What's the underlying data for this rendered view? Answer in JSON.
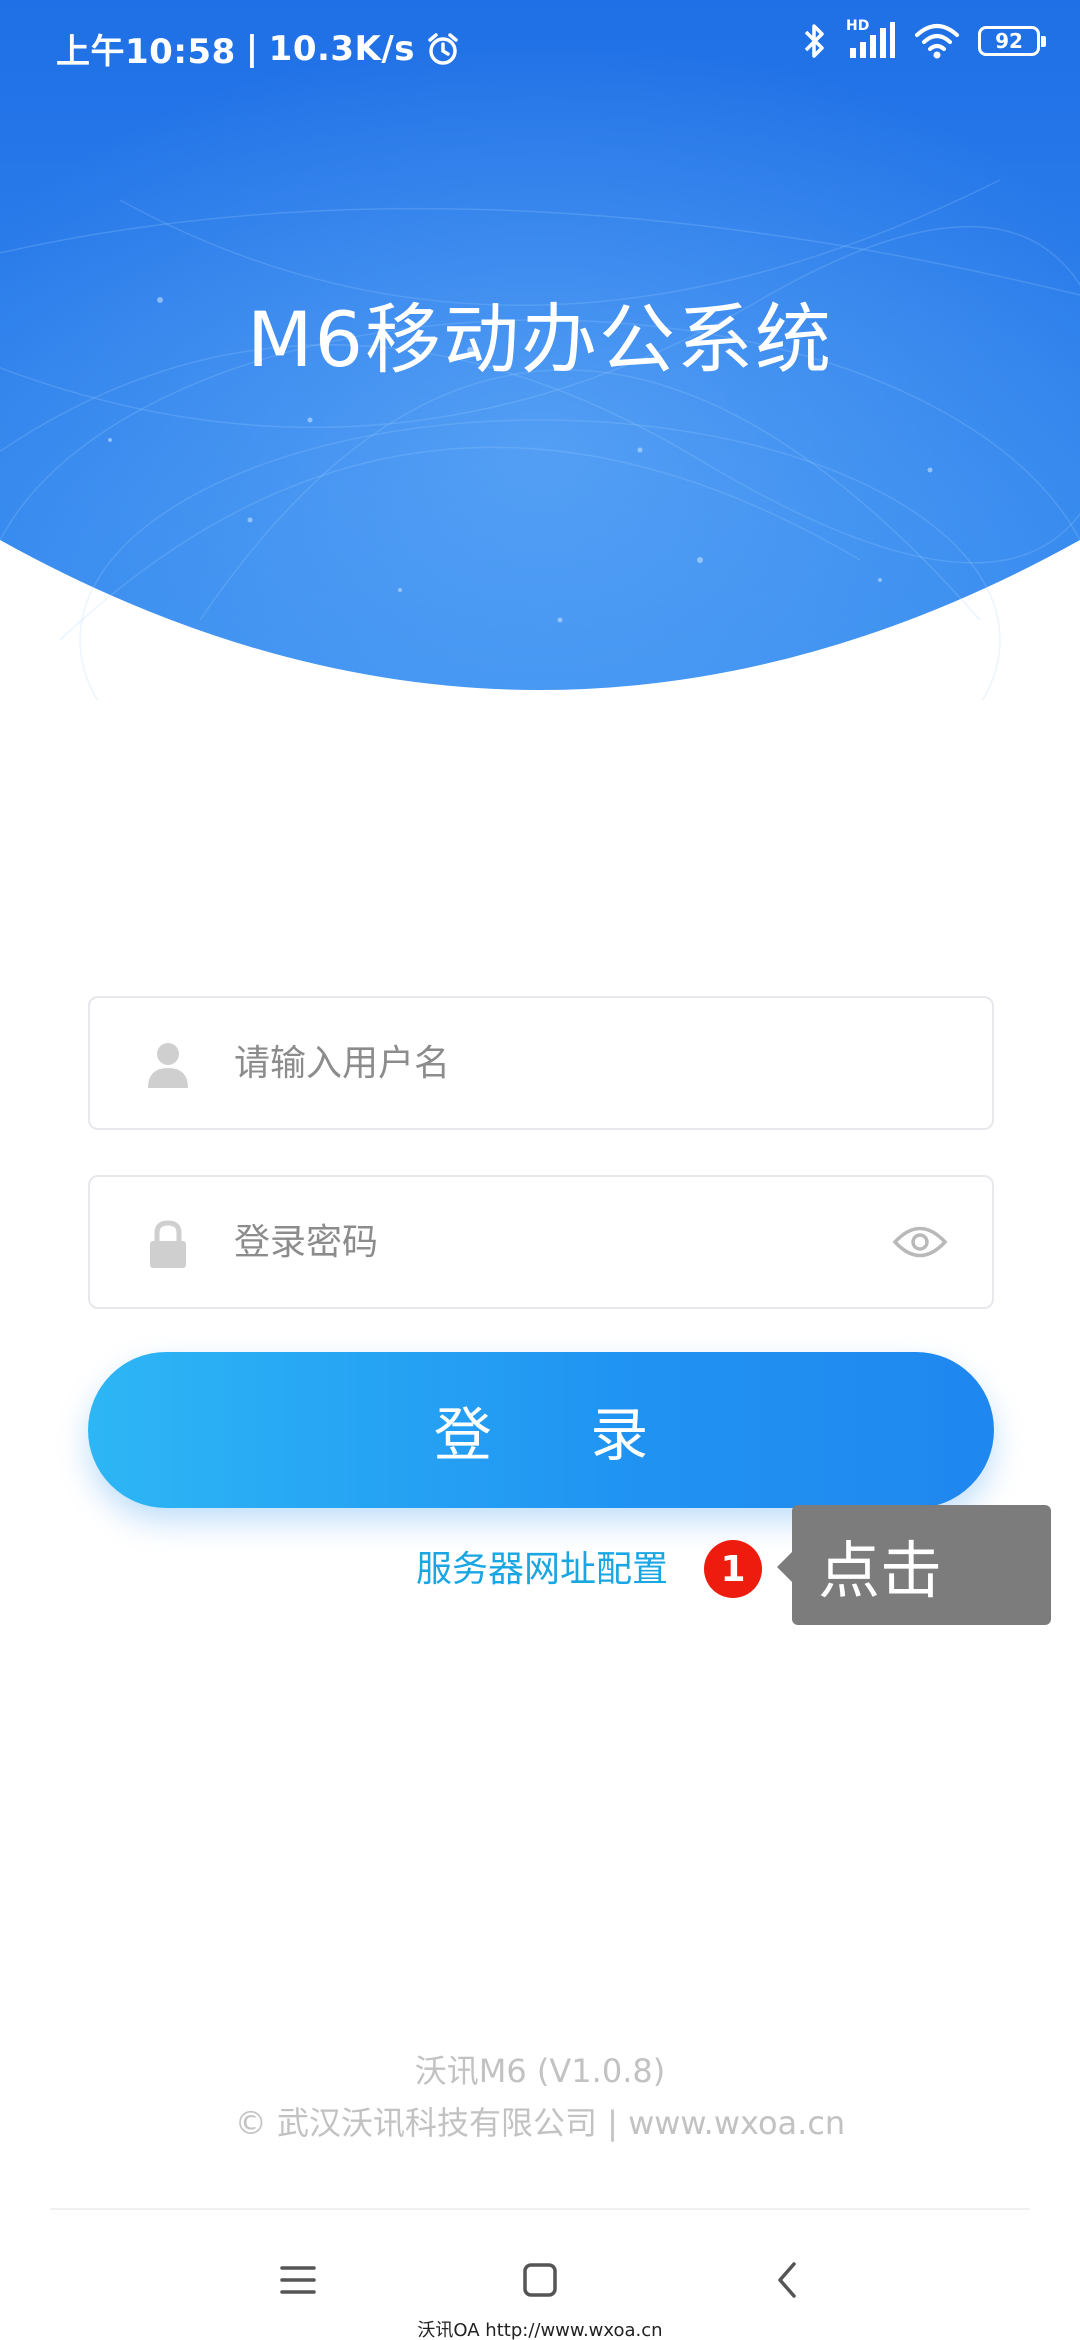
{
  "status_bar": {
    "time": "上午10:58",
    "separator": "|",
    "net_speed": "10.3K/s",
    "alarm_icon": "alarm-clock-icon",
    "bluetooth_icon": "bluetooth-icon",
    "signal_label": "HD",
    "signal_icon": "cellular-signal-icon",
    "wifi_icon": "wifi-icon",
    "battery_level": "92"
  },
  "header": {
    "title": "M6移动办公系统",
    "gradient_top": "#1f6fe6",
    "gradient_bottom": "#3a8ff0"
  },
  "login_form": {
    "username_placeholder": "请输入用户名",
    "username_value": "",
    "username_icon": "user-icon",
    "password_placeholder": "登录密码",
    "password_value": "",
    "password_icon": "lock-icon",
    "toggle_visibility_icon": "eye-icon",
    "login_button": "登 录",
    "server_config_link": "服务器网址配置"
  },
  "annotation": {
    "step_number": "1",
    "tip_text": "点击"
  },
  "footer": {
    "version": "沃讯M6 (V1.0.8)",
    "copyright": "© 武汉沃讯科技有限公司 | www.wxoa.cn"
  },
  "nav_bar": {
    "menu_icon": "menu-icon",
    "home_icon": "home-square-icon",
    "back_icon": "back-chevron-icon"
  },
  "watermark": "沃讯OA  http://www.wxoa.cn",
  "colors": {
    "accent": "#2093f2",
    "link": "#1aa6e2",
    "badge_red": "#ee1c0f",
    "tooltip_gray": "#7c7c7c"
  }
}
